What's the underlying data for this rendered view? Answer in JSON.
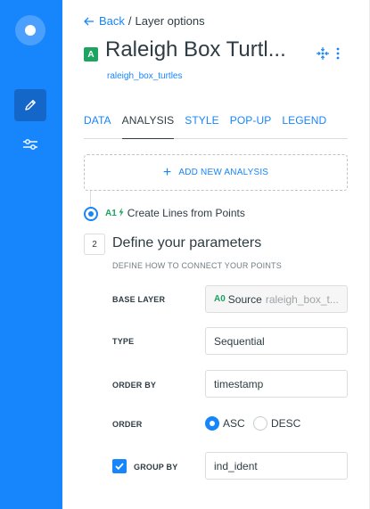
{
  "sidebar": {
    "items": [
      {
        "icon": "logo-icon"
      },
      {
        "icon": "pencil-icon",
        "active": true
      },
      {
        "icon": "sliders-icon"
      }
    ]
  },
  "header": {
    "back_label": "Back",
    "separator": "/",
    "crumb_current": "Layer options",
    "layer_badge": "A",
    "layer_title": "Raleigh Box Turtl...",
    "layer_source": "raleigh_box_turtles"
  },
  "tabs": [
    {
      "label": "DATA",
      "active": false
    },
    {
      "label": "ANALYSIS",
      "active": true
    },
    {
      "label": "STYLE",
      "active": false
    },
    {
      "label": "POP-UP",
      "active": false
    },
    {
      "label": "LEGEND",
      "active": false
    }
  ],
  "add_analysis": {
    "label": "ADD NEW ANALYSIS"
  },
  "analysis_node": {
    "id": "A1",
    "label": "Create Lines from Points"
  },
  "step": {
    "number": "2",
    "title": "Define your parameters",
    "subtitle": "DEFINE HOW TO CONNECT YOUR POINTS"
  },
  "fields": {
    "base_layer": {
      "label": "BASE LAYER",
      "node": "A0",
      "name": "Source",
      "value": "raleigh_box_t..."
    },
    "type": {
      "label": "TYPE",
      "value": "Sequential"
    },
    "order_by": {
      "label": "ORDER BY",
      "value": "timestamp"
    },
    "order": {
      "label": "ORDER",
      "options": [
        "ASC",
        "DESC"
      ],
      "selected": "ASC"
    },
    "group_by": {
      "label": "GROUP BY",
      "checked": true,
      "value": "ind_ident"
    }
  },
  "colors": {
    "accent": "#1785fb",
    "sidebar_bg": "#1785fb",
    "node_green": "#1da461",
    "text": "#2e3c43"
  }
}
